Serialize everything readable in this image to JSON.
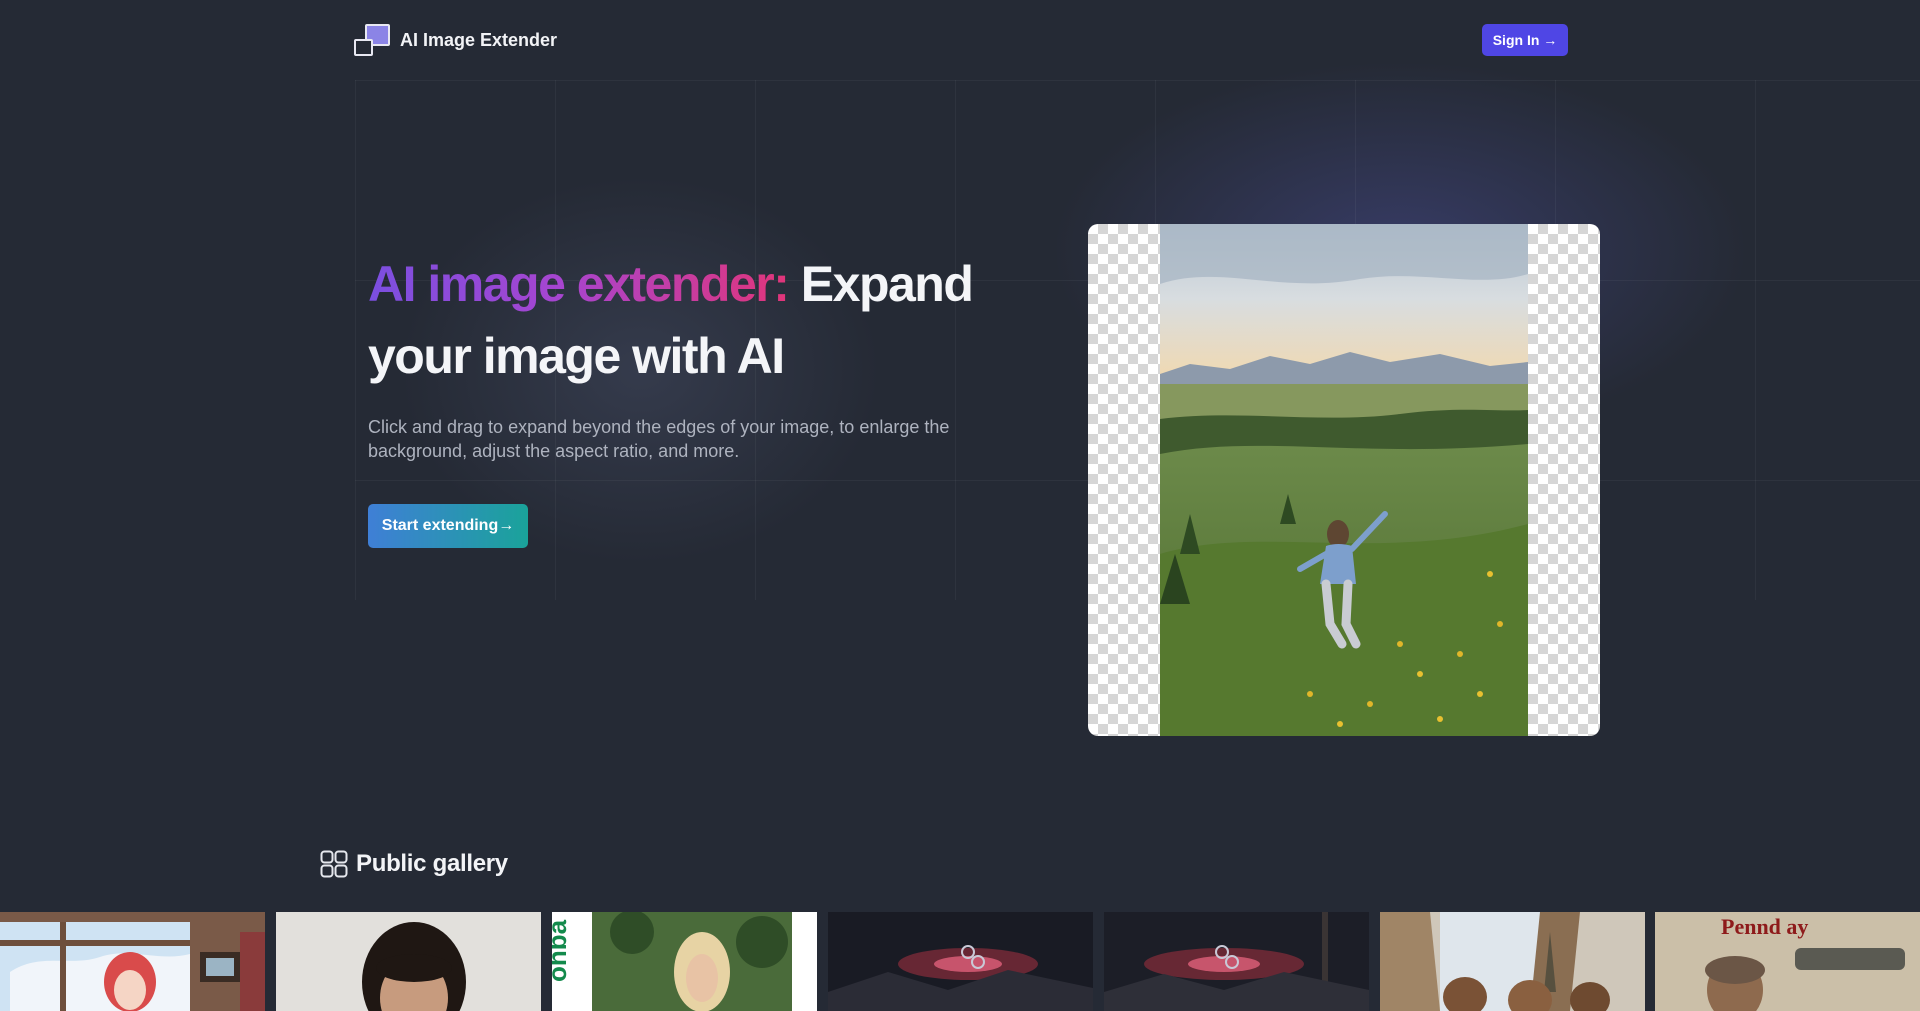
{
  "header": {
    "brand": "AI Image Extender",
    "signin_label": "Sign In →"
  },
  "hero": {
    "title_highlight": "AI image extender:",
    "title_rest": "Expand your image with AI",
    "description": "Click and drag to expand beyond the edges of your image, to enlarge the background, adjust the aspect ratio, and more.",
    "cta_label": "Start extending→"
  },
  "demo": {
    "icon": "mountain-meadow-photo"
  },
  "gallery": {
    "title": "Public gallery",
    "icon": "grid-icon",
    "thumbnails": [
      {
        "subject": "anime-girl-window"
      },
      {
        "subject": "woman-portrait"
      },
      {
        "subject": "blonde-woman-garden",
        "text": "ohba"
      },
      {
        "subject": "dark-nebula-mountains"
      },
      {
        "subject": "dark-nebula-mountains"
      },
      {
        "subject": "women-paris-cafe"
      },
      {
        "subject": "man-tank-poster",
        "text": "Pennd ay"
      }
    ]
  },
  "colors": {
    "background": "#252a35",
    "accent": "#4f46e5",
    "cta_start": "#3f7fd6",
    "cta_end": "#1aa39a"
  }
}
